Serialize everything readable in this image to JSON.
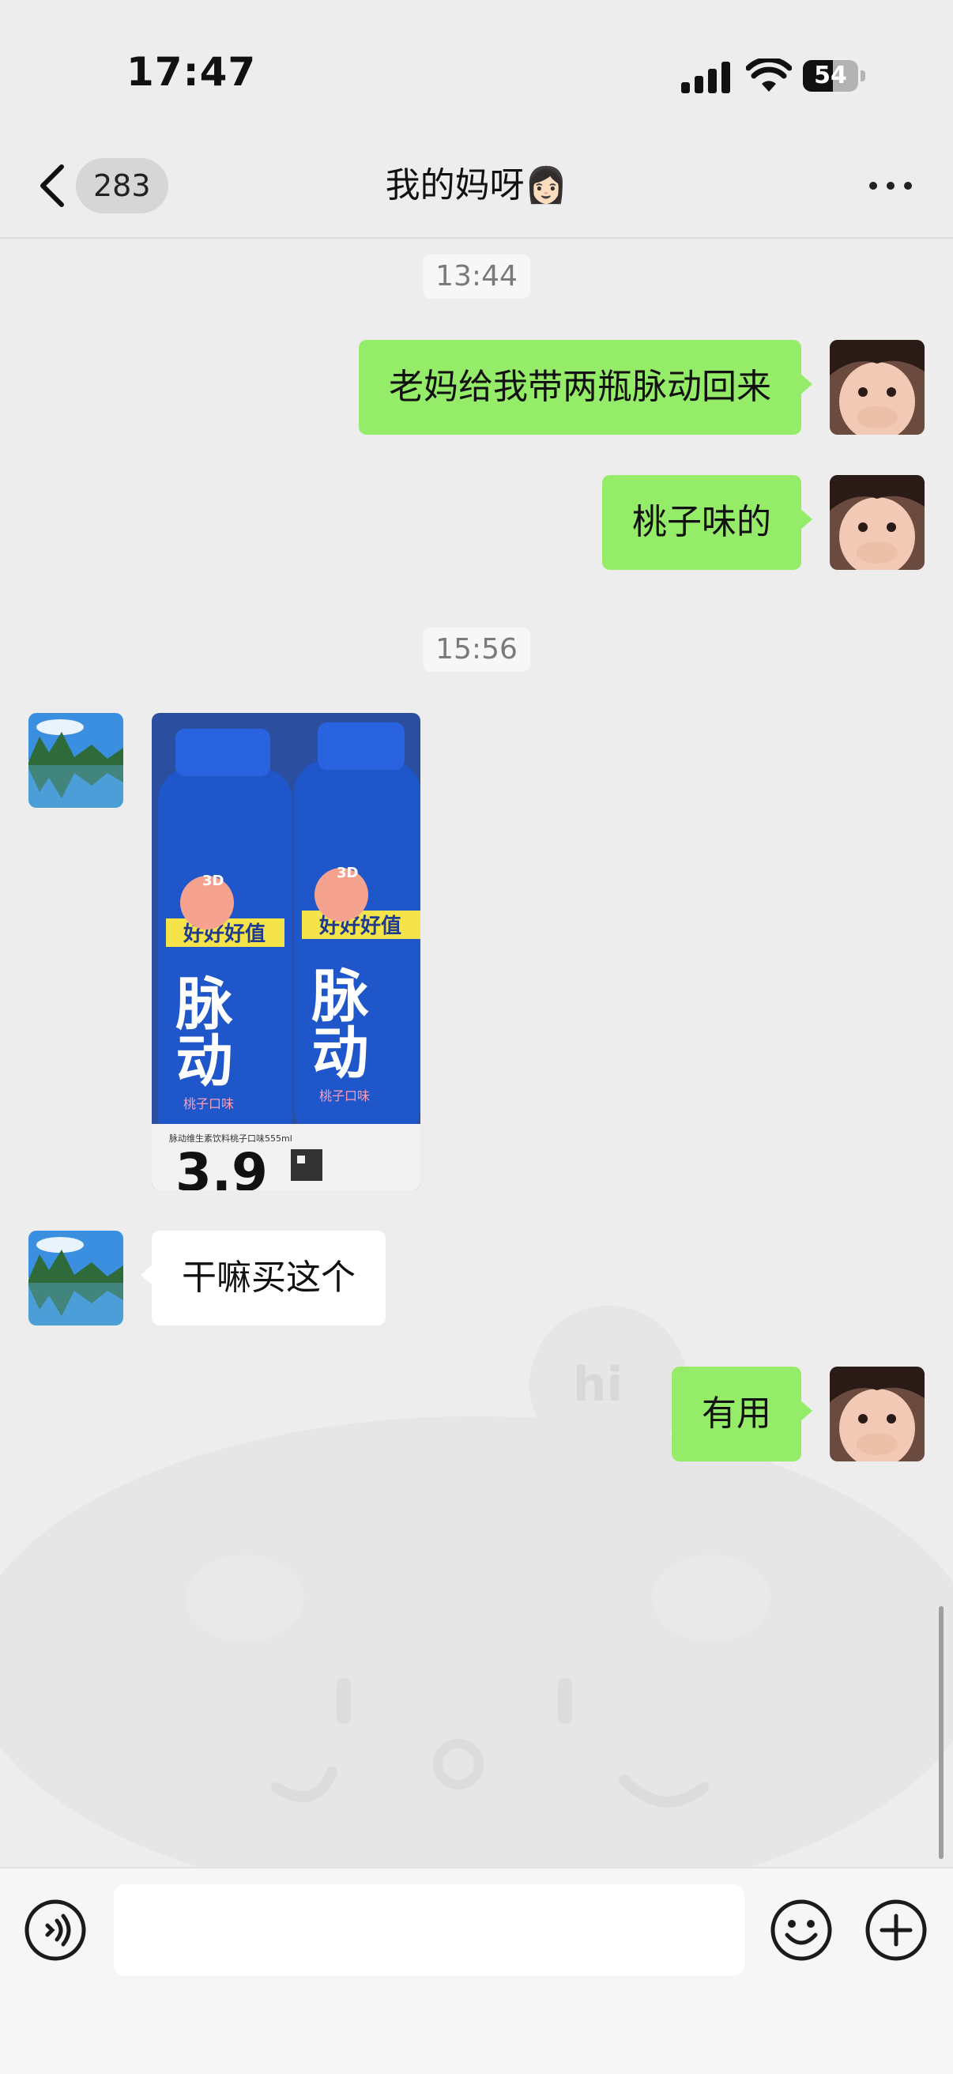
{
  "status_bar": {
    "time": "17:47",
    "battery_level": "54",
    "icons": [
      "signal-icon",
      "wifi-icon",
      "battery-icon"
    ]
  },
  "nav": {
    "back_icon": "chevron-left-icon",
    "unread_count": "283",
    "title": "我的妈呀👩🏻",
    "more_icon": "more-dots-icon"
  },
  "messages": [
    {
      "type": "time",
      "text": "13:44"
    },
    {
      "type": "text",
      "from": "me",
      "text": "老妈给我带两瓶脉动回来"
    },
    {
      "type": "text",
      "from": "me",
      "text": "桃子味的"
    },
    {
      "type": "time",
      "text": "15:56"
    },
    {
      "type": "image",
      "from": "them"
    },
    {
      "type": "text",
      "from": "them",
      "text": "干嘛买这个"
    },
    {
      "type": "text",
      "from": "me",
      "text": "有用"
    }
  ],
  "photo": {
    "brand_vertical": "脉动",
    "promo_band": "好好好值",
    "badge": "3D",
    "flavor": "桃子口味",
    "shelf_label": "脉动维生素饮料桃子口味555ml",
    "price": "3.9"
  },
  "input_bar": {
    "voice_icon": "voice-mode-icon",
    "mic_icon": "microphone-icon",
    "emoji_icon": "emoji-icon",
    "plus_icon": "plus-icon",
    "text_value": ""
  },
  "colors": {
    "chat_bg": "#ededed",
    "my_bubble": "#95ec69",
    "their_bubble": "#ffffff"
  }
}
